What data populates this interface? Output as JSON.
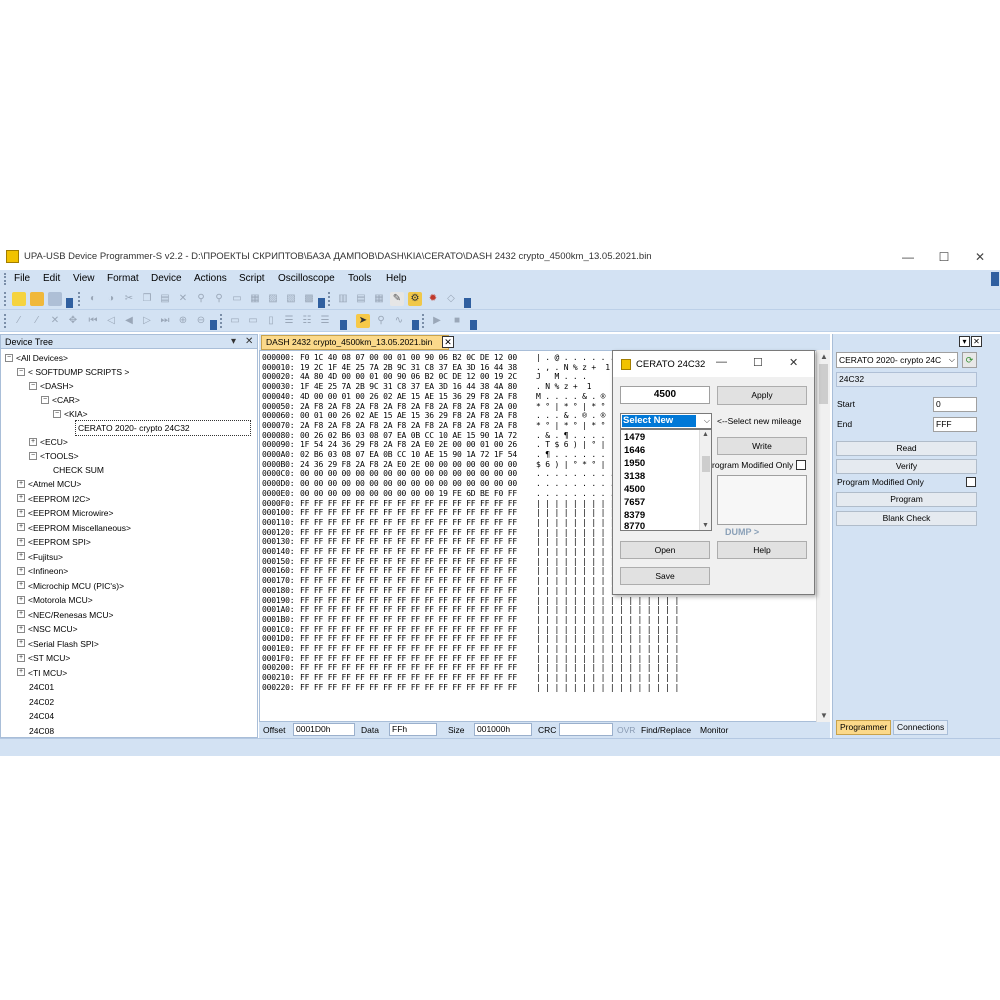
{
  "window": {
    "title": "UPA-USB Device Programmer-S v2.2 - D:\\ПРОЕКТЫ СКРИПТОВ\\БАЗА ДАМПОВ\\DASH\\KIA\\CERATO\\DASH 2432 crypto_4500km_13.05.2021.bin",
    "minimize": "—",
    "maximize": "☐",
    "close": "✕"
  },
  "menu": [
    "File",
    "Edit",
    "View",
    "Format",
    "Device",
    "Actions",
    "Script",
    "Oscilloscope",
    "Tools",
    "Help"
  ],
  "tree": {
    "title": "Device Tree",
    "pin": "▾",
    "close": "✕",
    "items": [
      {
        "label": "<All Devices>",
        "box": "−"
      },
      {
        "label": "< SOFTDUMP SCRIPTS >",
        "box": "−"
      },
      {
        "label": "<DASH>",
        "box": "−"
      },
      {
        "label": "<CAR>",
        "box": "−"
      },
      {
        "label": "<KIA>",
        "box": "−"
      },
      {
        "label": "CERATO 2020- crypto 24C32",
        "box": ""
      },
      {
        "label": "<ECU>",
        "box": "+"
      },
      {
        "label": "<TOOLS>",
        "box": "−"
      },
      {
        "label": "CHECK SUM",
        "box": ""
      },
      {
        "label": "<Atmel MCU>",
        "box": "+"
      },
      {
        "label": "<EEPROM I2C>",
        "box": "+"
      },
      {
        "label": "<EEPROM Microwire>",
        "box": "+"
      },
      {
        "label": "<EEPROM Miscellaneous>",
        "box": "+"
      },
      {
        "label": "<EEPROM SPI>",
        "box": "+"
      },
      {
        "label": "<Fujitsu>",
        "box": "+"
      },
      {
        "label": "<Infineon>",
        "box": "+"
      },
      {
        "label": "<Microchip MCU (PIC's)>",
        "box": "+"
      },
      {
        "label": "<Motorola MCU>",
        "box": "+"
      },
      {
        "label": "<NEC/Renesas MCU>",
        "box": "+"
      },
      {
        "label": "<NSC MCU>",
        "box": "+"
      },
      {
        "label": "<Serial Flash SPI>",
        "box": "+"
      },
      {
        "label": "<ST MCU>",
        "box": "+"
      },
      {
        "label": "<TI MCU>",
        "box": "+"
      },
      {
        "label": "24C01",
        "box": ""
      },
      {
        "label": "24C02",
        "box": ""
      },
      {
        "label": "24C04",
        "box": ""
      },
      {
        "label": "24C08",
        "box": ""
      }
    ]
  },
  "document": {
    "tab_label": "DASH 2432 crypto_4500km_13.05.2021.bin",
    "tab_close": "✕"
  },
  "hex": {
    "rows": [
      {
        "off": "000000:",
        "bytes": "F0 1C 40 08 07 00 00 01 00 90 06 B2 0C DE 12 00",
        "ascii": "| . @ . . . . . . . . . . . . ."
      },
      {
        "off": "000010:",
        "bytes": "19 2C 1F 4E 25 7A 2B 9C 31 C8 37 EA 3D 16 44 38",
        "ascii": ". , . N % z +  1"
      },
      {
        "off": "000020:",
        "bytes": "4A 80 4D 00 00 01 00 90 06 B2 0C DE 12 00 19 2C",
        "ascii": "J   M . . ."
      },
      {
        "off": "000030:",
        "bytes": "1F 4E 25 7A 2B 9C 31 C8 37 EA 3D 16 44 38 4A 80",
        "ascii": ". N % z +  1"
      },
      {
        "off": "000040:",
        "bytes": "4D 00 00 01 00 26 02 AE 15 AE 15 36 29 F8 2A F8",
        "ascii": "M . . . . & . ®"
      },
      {
        "off": "000050:",
        "bytes": "2A F8 2A F8 2A F8 2A F8 2A F8 2A F8 2A F8 2A 00",
        "ascii": "* ° | * ° | * °"
      },
      {
        "off": "000060:",
        "bytes": "00 01 00 26 02 AE 15 AE 15 36 29 F8 2A F8 2A F8",
        "ascii": ". . . & . ® . ®"
      },
      {
        "off": "000070:",
        "bytes": "2A F8 2A F8 2A F8 2A F8 2A F8 2A F8 2A F8 2A F8",
        "ascii": "* ° | * ° | * °"
      },
      {
        "off": "000080:",
        "bytes": "00 26 02 B6 03 08 07 EA 0B CC 10 AE 15 90 1A 72",
        "ascii": ". & . ¶ . . . ."
      },
      {
        "off": "000090:",
        "bytes": "1F 54 24 36 29 F8 2A F8 2A E0 2E 00 00 01 00 26",
        "ascii": ". T $ 6 ) | ° |"
      },
      {
        "off": "0000A0:",
        "bytes": "02 B6 03 08 07 EA 0B CC 10 AE 15 90 1A 72 1F 54",
        "ascii": ". ¶ . . . . . ."
      },
      {
        "off": "0000B0:",
        "bytes": "24 36 29 F8 2A F8 2A E0 2E 00 00 00 00 00 00 00",
        "ascii": "$ 6 ) | ° * ° |"
      },
      {
        "off": "0000C0:",
        "bytes": "00 00 00 00 00 00 00 00 00 00 00 00 00 00 00 00",
        "ascii": ". . . . . . . . . . . . . . . ."
      },
      {
        "off": "0000D0:",
        "bytes": "00 00 00 00 00 00 00 00 00 00 00 00 00 00 00 00",
        "ascii": ". . . . . . . . . . . . . . . ."
      },
      {
        "off": "0000E0:",
        "bytes": "00 00 00 00 00 00 00 00 00 00 19 FE 6D BE F0 FF",
        "ascii": ". . . . . . . . . . . . . . . ."
      },
      {
        "off": "0000F0:",
        "bytes": "FF FF FF FF FF FF FF FF FF FF FF FF FF FF FF FF",
        "ascii": "| | | | | | | | | | | | | | | |"
      },
      {
        "off": "000100:",
        "bytes": "FF FF FF FF FF FF FF FF FF FF FF FF FF FF FF FF",
        "ascii": "| | | | | | | | | | | | | | | |"
      },
      {
        "off": "000110:",
        "bytes": "FF FF FF FF FF FF FF FF FF FF FF FF FF FF FF FF",
        "ascii": "| | | | | | | | | | | | | | | |"
      },
      {
        "off": "000120:",
        "bytes": "FF FF FF FF FF FF FF FF FF FF FF FF FF FF FF FF",
        "ascii": "| | | | | | | | | | | | | | | |"
      },
      {
        "off": "000130:",
        "bytes": "FF FF FF FF FF FF FF FF FF FF FF FF FF FF FF FF",
        "ascii": "| | | | | | | | | | | | | | | |"
      },
      {
        "off": "000140:",
        "bytes": "FF FF FF FF FF FF FF FF FF FF FF FF FF FF FF FF",
        "ascii": "| | | | | | | | | | | | | | | |"
      },
      {
        "off": "000150:",
        "bytes": "FF FF FF FF FF FF FF FF FF FF FF FF FF FF FF FF",
        "ascii": "| | | | | | | | | | | | | | | |"
      },
      {
        "off": "000160:",
        "bytes": "FF FF FF FF FF FF FF FF FF FF FF FF FF FF FF FF",
        "ascii": "| | | | | | | | | | | | | | | |"
      },
      {
        "off": "000170:",
        "bytes": "FF FF FF FF FF FF FF FF FF FF FF FF FF FF FF FF",
        "ascii": "| | | | | | | | | | | | | | | |"
      },
      {
        "off": "000180:",
        "bytes": "FF FF FF FF FF FF FF FF FF FF FF FF FF FF FF FF",
        "ascii": "| | | | | | | | | | | | | | | |"
      },
      {
        "off": "000190:",
        "bytes": "FF FF FF FF FF FF FF FF FF FF FF FF FF FF FF FF",
        "ascii": "| | | | | | | | | | | | | | | |"
      },
      {
        "off": "0001A0:",
        "bytes": "FF FF FF FF FF FF FF FF FF FF FF FF FF FF FF FF",
        "ascii": "| | | | | | | | | | | | | | | |"
      },
      {
        "off": "0001B0:",
        "bytes": "FF FF FF FF FF FF FF FF FF FF FF FF FF FF FF FF",
        "ascii": "| | | | | | | | | | | | | | | |"
      },
      {
        "off": "0001C0:",
        "bytes": "FF FF FF FF FF FF FF FF FF FF FF FF FF FF FF FF",
        "ascii": "| | | | | | | | | | | | | | | |"
      },
      {
        "off": "0001D0:",
        "bytes": "FF FF FF FF FF FF FF FF FF FF FF FF FF FF FF FF",
        "ascii": "| | | | | | | | | | | | | | | |"
      },
      {
        "off": "0001E0:",
        "bytes": "FF FF FF FF FF FF FF FF FF FF FF FF FF FF FF FF",
        "ascii": "| | | | | | | | | | | | | | | |"
      },
      {
        "off": "0001F0:",
        "bytes": "FF FF FF FF FF FF FF FF FF FF FF FF FF FF FF FF",
        "ascii": "| | | | | | | | | | | | | | | |"
      },
      {
        "off": "000200:",
        "bytes": "FF FF FF FF FF FF FF FF FF FF FF FF FF FF FF FF",
        "ascii": "| | | | | | | | | | | | | | | |"
      },
      {
        "off": "000210:",
        "bytes": "FF FF FF FF FF FF FF FF FF FF FF FF FF FF FF FF",
        "ascii": "| | | | | | | | | | | | | | | |"
      },
      {
        "off": "000220:",
        "bytes": "FF FF FF FF FF FF FF FF FF FF FF FF FF FF FF FF",
        "ascii": "| | | | | | | | | | | | | | | |"
      }
    ]
  },
  "status": {
    "offset_label": "Offset",
    "offset_value": "0001D0h",
    "data_label": "Data",
    "data_value": "FFh",
    "size_label": "Size",
    "size_value": "001000h",
    "crc_label": "CRC",
    "crc_value": "",
    "ovr": "OVR",
    "find_replace": "Find/Replace",
    "monitor": "Monitor"
  },
  "dialog": {
    "title": "CERATO 24C32",
    "minimize": "—",
    "maximize": "☐",
    "close": "✕",
    "mileage_value": "4500",
    "apply": "Apply",
    "select_value": "Select New",
    "select_hint": "<--Select new mileage",
    "options": [
      "1479",
      "1646",
      "1950",
      "3138",
      "4500",
      "7657",
      "8379",
      "8770"
    ],
    "write": "Write",
    "modified_only": "rogram Modified Only",
    "dump_label": "DUMP >",
    "open": "Open",
    "help": "Help",
    "save": "Save"
  },
  "programmer": {
    "chip_select": "CERATO 2020- crypto 24C",
    "chip_name": "24C32",
    "start_label": "Start",
    "start_value": "0",
    "end_label": "End",
    "end_value": "FFF",
    "read": "Read",
    "verify": "Verify",
    "modified_only": "Program Modified Only",
    "program": "Program",
    "blank_check": "Blank Check",
    "tab_programmer": "Programmer",
    "tab_connections": "Connections"
  },
  "colors": {
    "chrome": "#d3e2f3",
    "doc_tab": "#fbd98a",
    "selection": "#0078d7"
  }
}
